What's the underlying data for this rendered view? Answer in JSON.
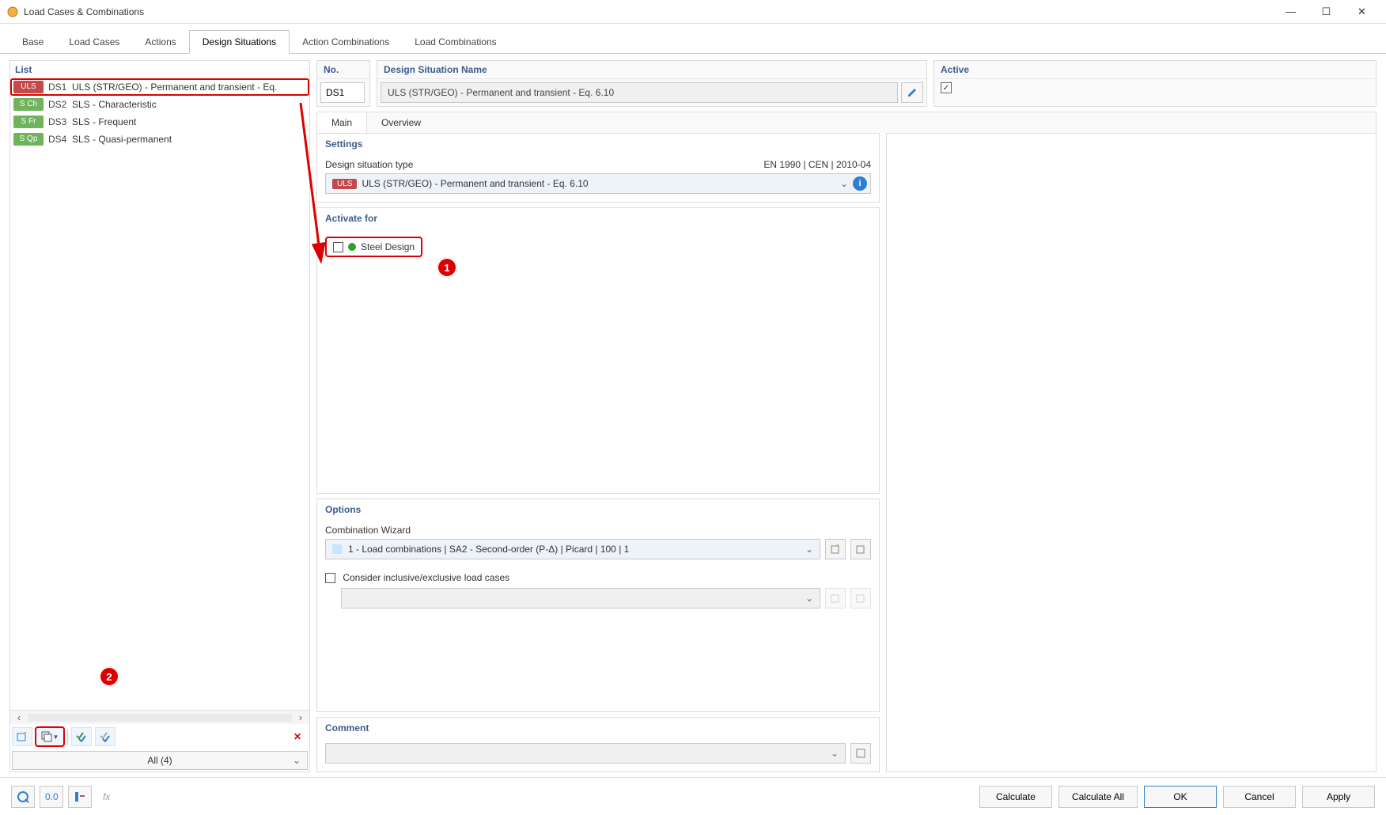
{
  "window": {
    "title": "Load Cases & Combinations"
  },
  "tabs": [
    "Base",
    "Load Cases",
    "Actions",
    "Design Situations",
    "Action Combinations",
    "Load Combinations"
  ],
  "tabs_active": 3,
  "list": {
    "header": "List",
    "rows": [
      {
        "tag": "ULS",
        "tagColor": "#c34a4a",
        "code": "DS1",
        "text": "ULS (STR/GEO) - Permanent and transient - Eq.",
        "selected": true
      },
      {
        "tag": "S Ch",
        "tagColor": "#6fb35a",
        "code": "DS2",
        "text": "SLS - Characteristic",
        "selected": false
      },
      {
        "tag": "S Fr",
        "tagColor": "#6fb35a",
        "code": "DS3",
        "text": "SLS - Frequent",
        "selected": false
      },
      {
        "tag": "S Qp",
        "tagColor": "#6fb35a",
        "code": "DS4",
        "text": "SLS - Quasi-permanent",
        "selected": false
      }
    ],
    "filter": "All (4)"
  },
  "top": {
    "no_label": "No.",
    "no_value": "DS1",
    "name_label": "Design Situation Name",
    "name_value": "ULS (STR/GEO) - Permanent and transient - Eq. 6.10",
    "active_label": "Active",
    "active_checked": true
  },
  "sub_tabs": [
    "Main",
    "Overview"
  ],
  "sub_tabs_active": 0,
  "settings": {
    "header": "Settings",
    "type_label": "Design situation type",
    "type_standard": "EN 1990 | CEN | 2010-04",
    "type_value": "ULS (STR/GEO) - Permanent and transient - Eq. 6.10"
  },
  "activate": {
    "header": "Activate for",
    "item_label": "Steel Design"
  },
  "options": {
    "header": "Options",
    "wizard_label": "Combination Wizard",
    "wizard_value": "1 - Load combinations | SA2 - Second-order (P-Δ) | Picard | 100 | 1",
    "consider_label": "Consider inclusive/exclusive load cases"
  },
  "comment": {
    "header": "Comment",
    "value": ""
  },
  "footer": {
    "calculate": "Calculate",
    "calculate_all": "Calculate All",
    "ok": "OK",
    "cancel": "Cancel",
    "apply": "Apply"
  },
  "callouts": {
    "c1": "1",
    "c2": "2"
  }
}
